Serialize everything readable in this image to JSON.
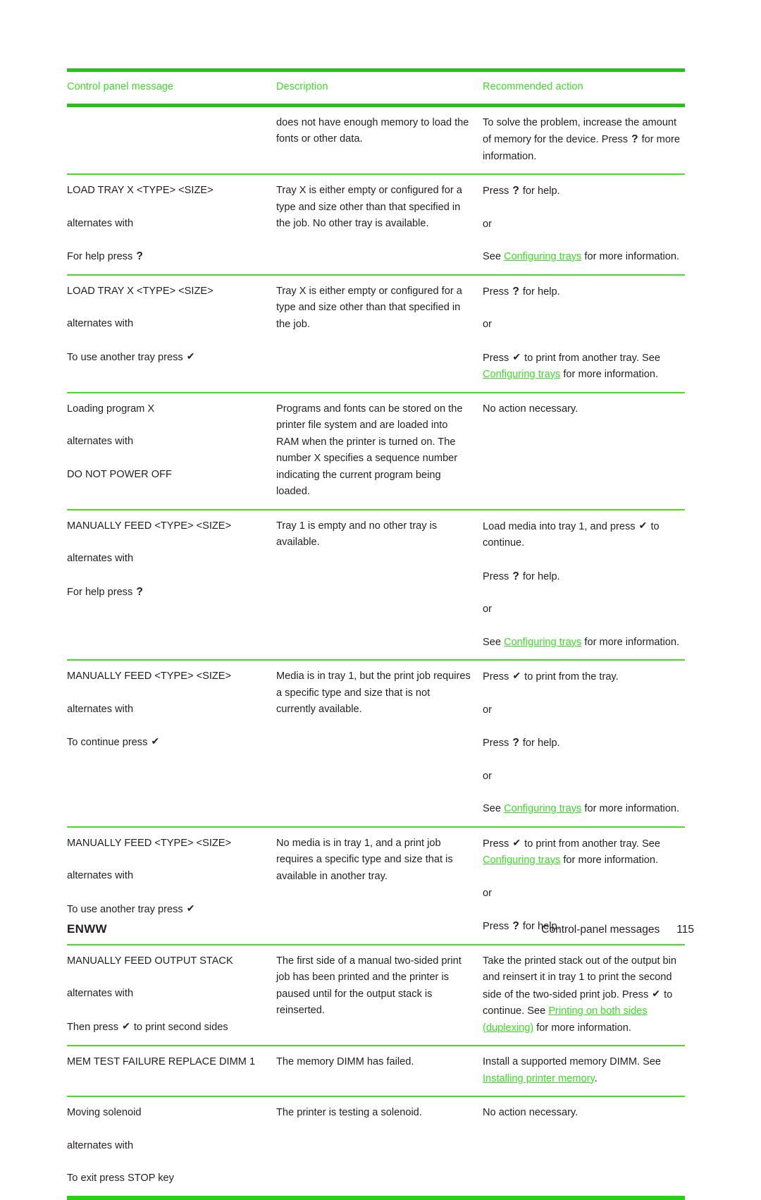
{
  "document": {
    "glyphs": {
      "help_key": "?",
      "select_key": "✔"
    },
    "colors": {
      "accent_green": "#3ae024",
      "rule_green": "#23c213",
      "rule_light_green": "#4ddb2b",
      "text": "#231f20"
    }
  },
  "table": {
    "headers": {
      "col1": "Control panel message",
      "col2": "Description",
      "col3": "Recommended action"
    },
    "rows": [
      {
        "message_lines": [],
        "description": "does not have enough memory to load the fonts or other data.",
        "action_pre": "To solve the problem, increase the amount of memory for the device. Press ",
        "action_post": " for more information."
      },
      {
        "message_line1": "LOAD TRAY X <TYPE> <SIZE>",
        "alternates": "alternates with",
        "message_line2_pre": "For help press ",
        "description": "Tray X is either empty or configured for a type and size other than that specified in the job. No other tray is available.",
        "action_press": "Press ",
        "action_press_post": " for help.",
        "action_or": "or",
        "action_see_pre": "See ",
        "action_link": "Configuring trays",
        "action_see_post": " for more information."
      },
      {
        "message_line1": "LOAD TRAY X <TYPE> <SIZE>",
        "alternates": "alternates with",
        "message_line2_pre": "To use another tray press ",
        "description": "Tray X is either empty or configured for a type and size other than that specified in the job.",
        "action_press": "Press ",
        "action_press_post": " for help.",
        "action_or": "or",
        "action_press2_pre": "Press ",
        "action_press2_post": " to print from another tray. See ",
        "action_link": "Configuring trays",
        "action_link_post": " for more information."
      },
      {
        "message_line1": "Loading program X",
        "alternates": "alternates with",
        "message_line2": "DO NOT POWER OFF",
        "description": "Programs and fonts can be stored on the printer file system and are loaded into RAM when the printer is turned on. The number X specifies a sequence number indicating the current program being loaded.",
        "action": "No action necessary."
      },
      {
        "message_line1": "MANUALLY FEED <TYPE> <SIZE>",
        "alternates": "alternates with",
        "message_line2_pre": "For help press ",
        "description": "Tray 1 is empty and no other tray is available.",
        "action_load_pre": "Load media into tray 1, and press ",
        "action_load_post": " to continue.",
        "action_press": "Press ",
        "action_press_post": " for help.",
        "action_or": "or",
        "action_see_pre": "See ",
        "action_link": "Configuring trays",
        "action_see_post": " for more information."
      },
      {
        "message_line1": "MANUALLY FEED <TYPE> <SIZE>",
        "alternates": "alternates with",
        "message_line2_pre": "To continue press ",
        "description": "Media is in tray 1, but the print job requires a specific type and size that is not currently available.",
        "action_press1_pre": "Press ",
        "action_press1_post": " to print from the tray.",
        "action_or1": "or",
        "action_press2_pre": "Press ",
        "action_press2_post": " for help.",
        "action_or2": "or",
        "action_see_pre": "See ",
        "action_link": "Configuring trays",
        "action_see_post": " for more information."
      },
      {
        "message_line1": "MANUALLY FEED <TYPE> <SIZE>",
        "alternates": "alternates with",
        "message_line2_pre": "To use another tray press ",
        "description": "No media is in tray 1, and a print job requires a specific type and size that is available in another tray.",
        "action_press1_pre": "Press ",
        "action_press1_post": " to print from another tray. See ",
        "action_link": "Configuring trays",
        "action_link_post": " for more information.",
        "action_or": "or",
        "action_press2_pre": "Press ",
        "action_press2_post": " for help."
      },
      {
        "message_line1": "MANUALLY FEED OUTPUT STACK",
        "alternates": "alternates with",
        "message_line2_pre": "Then press ",
        "message_line2_post": " to print second sides",
        "description": "The first side of a manual two-sided print job has been printed and the printer is paused until for the output stack is reinserted.",
        "action_pre": "Take the printed stack out of the output bin and reinsert it in tray 1 to print the second side of the two-sided print job. Press ",
        "action_mid": " to continue. See ",
        "action_link": "Printing on both sides (duplexing)",
        "action_post": " for more information."
      },
      {
        "message_line1": "MEM TEST FAILURE REPLACE DIMM 1",
        "description": "The memory DIMM has failed.",
        "action_pre": "Install a supported memory DIMM. See ",
        "action_link": "Installing printer memory",
        "action_post": "."
      },
      {
        "message_line1": "Moving solenoid",
        "alternates": "alternates with",
        "message_line2": "To exit press STOP key",
        "description": "The printer is testing a solenoid.",
        "action": "No action necessary."
      }
    ]
  },
  "footer": {
    "left": "ENWW",
    "section": "Control-panel messages",
    "page_number": "115"
  }
}
